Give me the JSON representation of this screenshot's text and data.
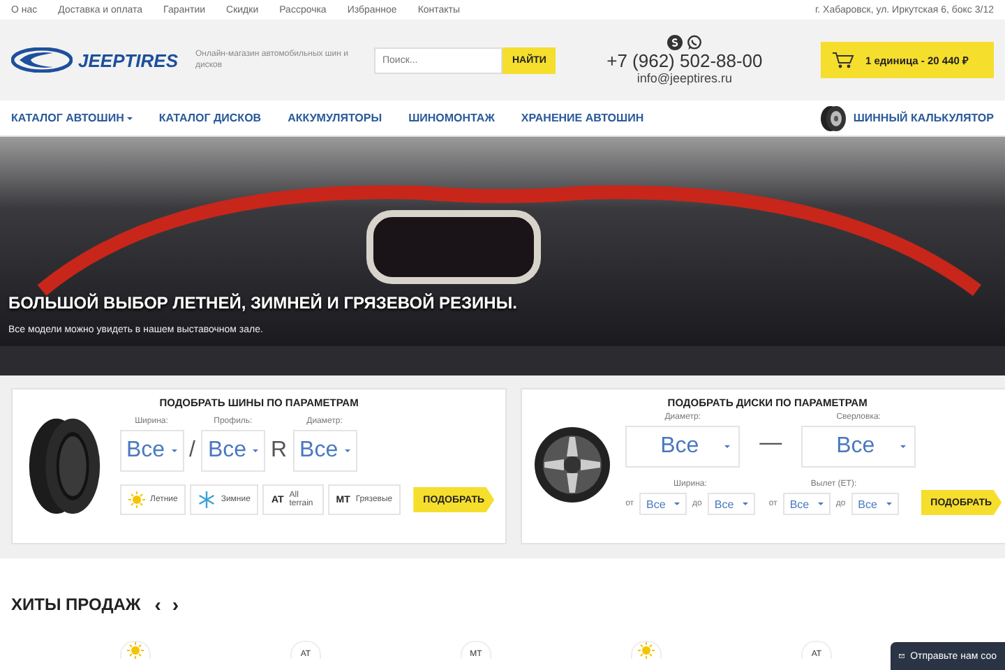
{
  "top_links": [
    "О нас",
    "Доставка и оплата",
    "Гарантии",
    "Скидки",
    "Рассрочка",
    "Избранное",
    "Контакты"
  ],
  "address": "г. Хабаровск, ул. Иркутская 6, бокс 3/12",
  "header": {
    "logo": "JEEPTIRES",
    "tagline": "Онлайн-магазин автомобильных шин и дисков",
    "search": {
      "placeholder": "Поиск...",
      "button": "НАЙТИ"
    },
    "phone": "+7 (962) 502-88-00",
    "email": "info@jeeptires.ru",
    "cart": "1 единица - 20 440 ₽"
  },
  "nav": [
    {
      "label": "КАТАЛОГ АВТОШИН",
      "dropdown": true
    },
    {
      "label": "КАТАЛОГ ДИСКОВ",
      "dropdown": false
    },
    {
      "label": "АККУМУЛЯТОРЫ",
      "dropdown": false
    },
    {
      "label": "ШИНОМОНТАЖ",
      "dropdown": false
    },
    {
      "label": "ХРАНЕНИЕ АВТОШИН",
      "dropdown": false
    }
  ],
  "calculator": "ШИННЫЙ КАЛЬКУЛЯТОР",
  "hero": {
    "title": "БОЛЬШОЙ ВЫБОР ЛЕТНЕЙ, ЗИМНЕЙ И ГРЯЗЕВОЙ РЕЗИНЫ.",
    "subtitle": "Все модели можно увидеть в нашем выставочном зале."
  },
  "tire_filter": {
    "title": "ПОДОБРАТЬ ШИНЫ ПО ПАРАМЕТРАМ",
    "fields": [
      {
        "label": "Ширина:",
        "value": "Все"
      },
      {
        "label": "Профиль:",
        "value": "Все"
      },
      {
        "label": "Диаметр:",
        "value": "Все"
      }
    ],
    "separators": [
      "/",
      "R"
    ],
    "seasons": [
      {
        "kind": "summer",
        "label": "Летние"
      },
      {
        "kind": "winter",
        "label": "Зимние"
      },
      {
        "kind": "code",
        "code": "AT",
        "label": "All terrain"
      },
      {
        "kind": "code",
        "code": "MT",
        "label": "Грязевые"
      }
    ],
    "button": "ПОДОБРАТЬ"
  },
  "disk_filter": {
    "title": "ПОДОБРАТЬ ДИСКИ ПО ПАРАМЕТРАМ",
    "main_fields": [
      {
        "label": "Диаметр:",
        "value": "Все"
      },
      {
        "label": "Сверловка:",
        "value": "Все"
      }
    ],
    "dash": "—",
    "range_fields": [
      {
        "label": "Ширина:",
        "from_label": "от",
        "from": "Все",
        "to_label": "до",
        "to": "Все"
      },
      {
        "label": "Вылет (ET):",
        "from_label": "от",
        "from": "Все",
        "to_label": "до",
        "to": "Все"
      }
    ],
    "button": "ПОДОБРАТЬ"
  },
  "hits": {
    "title": "ХИТЫ ПРОДАЖ",
    "prev": "‹",
    "next": "›",
    "badges": [
      {
        "kind": "summer"
      },
      {
        "kind": "code",
        "code": "AT"
      },
      {
        "kind": "code",
        "code": "MT"
      },
      {
        "kind": "summer"
      },
      {
        "kind": "code",
        "code": "AT"
      }
    ]
  },
  "chat": {
    "label": "Отправьте нам соо"
  }
}
